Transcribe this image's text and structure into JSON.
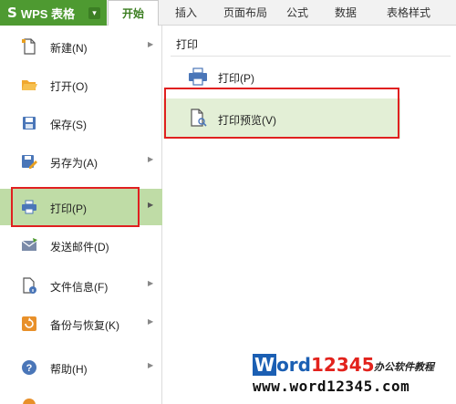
{
  "app": {
    "logo": "S",
    "name": "WPS 表格",
    "arrow": "▾"
  },
  "tabs": [
    {
      "label": "开始",
      "active": true
    },
    {
      "label": "插入"
    },
    {
      "label": "页面布局"
    },
    {
      "label": "公式"
    },
    {
      "label": "数据"
    },
    {
      "label": "表格样式"
    }
  ],
  "left_menu": [
    {
      "label": "新建(N)",
      "icon": "new-doc-icon",
      "submenu": true
    },
    {
      "label": "打开(O)",
      "icon": "folder-open-icon",
      "submenu": false
    },
    {
      "label": "保存(S)",
      "icon": "save-icon",
      "submenu": false
    },
    {
      "label": "另存为(A)",
      "icon": "save-as-icon",
      "submenu": true
    },
    {
      "label": "打印(P)",
      "icon": "printer-icon",
      "submenu": true,
      "highlighted": true
    },
    {
      "label": "发送邮件(D)",
      "icon": "mail-icon",
      "submenu": false
    },
    {
      "label": "文件信息(F)",
      "icon": "file-info-icon",
      "submenu": true
    },
    {
      "label": "备份与恢复(K)",
      "icon": "backup-icon",
      "submenu": true
    },
    {
      "label": "帮助(H)",
      "icon": "help-icon",
      "submenu": true
    }
  ],
  "submenu_arrow": "▶",
  "right_panel": {
    "title": "打印",
    "items": [
      {
        "label": "打印(P)",
        "icon": "printer-icon"
      },
      {
        "label": "打印预览(V)",
        "icon": "print-preview-icon",
        "highlighted": true
      }
    ]
  },
  "watermark": {
    "w": "W",
    "ord": "ord",
    "num": "12345",
    "cn": "办公软件教程",
    "url": "www.word12345.com"
  },
  "colors": {
    "brand_green": "#4e9a31",
    "highlight_green": "#bfdca6",
    "preview_green": "#e3efd6",
    "annotation_red": "#e02020",
    "icon_blue": "#4a76b8"
  }
}
